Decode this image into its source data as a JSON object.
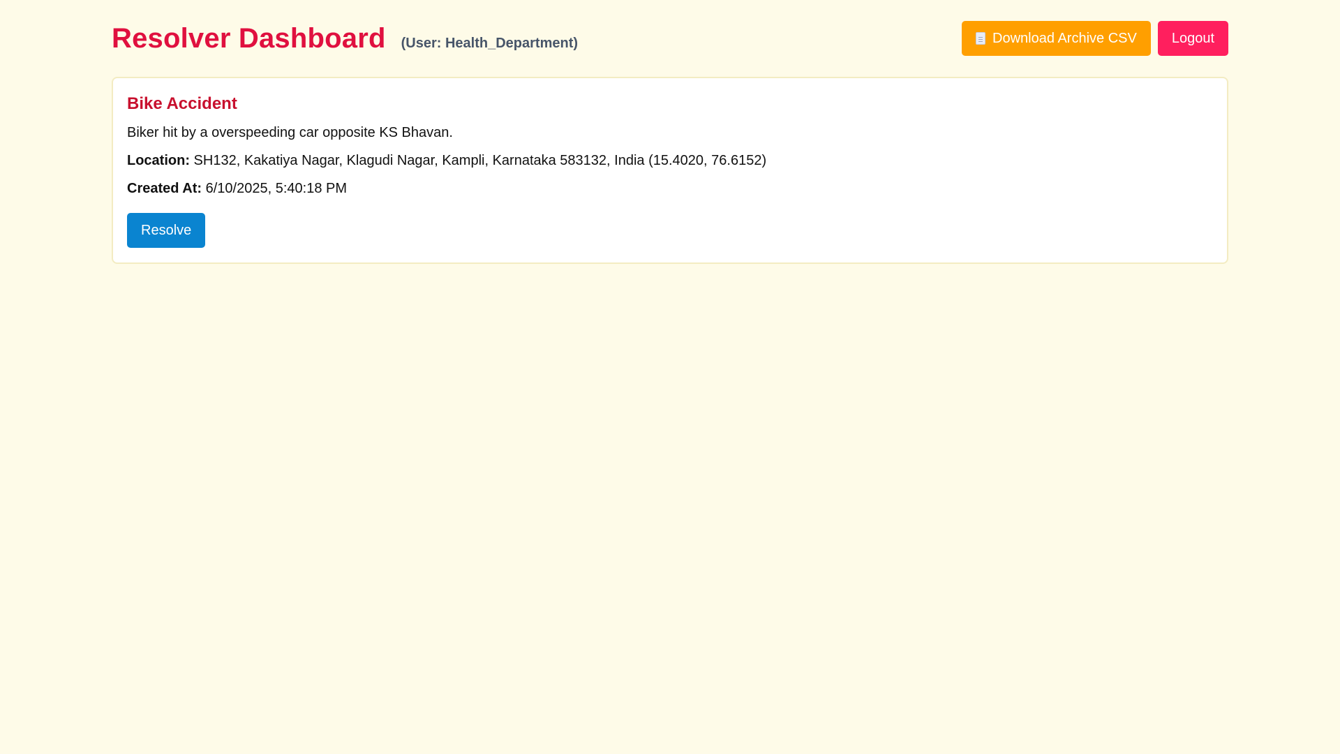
{
  "header": {
    "title": "Resolver Dashboard",
    "user_label": "(User: Health_Department)",
    "download_label": "Download Archive CSV",
    "logout_label": "Logout"
  },
  "incidents": [
    {
      "title": "Bike Accident",
      "description": "Biker hit by a overspeeding car opposite KS Bhavan.",
      "location_label": "Location:",
      "location_value": " SH132, Kakatiya Nagar, Klagudi Nagar, Kampli, Karnataka 583132, India (15.4020, 76.6152)",
      "created_label": "Created At:",
      "created_value": " 6/10/2025, 5:40:18 PM",
      "resolve_label": "Resolve"
    }
  ],
  "icons": {
    "download": "document-icon"
  },
  "colors": {
    "background": "#fefbe8",
    "title": "#e0103f",
    "download_button": "#ff9f00",
    "logout_button": "#ff1f5e",
    "resolve_button": "#0a84d0"
  }
}
